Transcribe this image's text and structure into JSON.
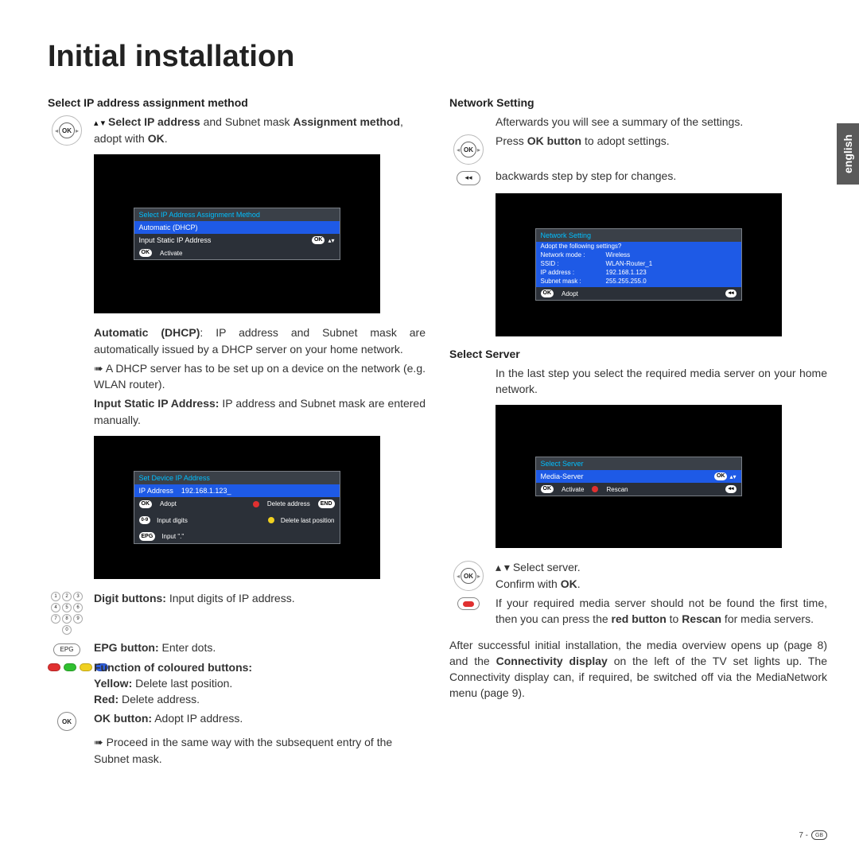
{
  "page_title": "Initial installation",
  "language_tab": "english",
  "footer": {
    "page": "7 -",
    "region": "GB"
  },
  "left": {
    "section1_title": "Select IP address assignment method",
    "instr1_pre": "▴ ▾ ",
    "instr1_bold1": "Select IP address",
    "instr1_mid": " and Subnet mask ",
    "instr1_bold2": "Assignment method",
    "instr1_tail": ",",
    "instr1_line2a": "adopt with ",
    "instr1_line2b": "OK",
    "instr1_line2c": ".",
    "tv1": {
      "header": "Select IP Address Assignment Method",
      "row1": "Automatic (DHCP)",
      "row2": "Input Static IP Address",
      "footer_ok": "OK",
      "footer_label": "Activate"
    },
    "auto_label": "Automatic (DHCP)",
    "auto_text": ": IP address and Subnet mask are automatically issued by a DHCP server on your home network.",
    "auto_bullet": "A DHCP server has to be set up on a device on the network (e.g. WLAN router).",
    "static_label": "Input Static IP Address:",
    "static_text": " IP address and Subnet mask are entered manually.",
    "tv2": {
      "header": "Set Device IP Address",
      "ip_label": "IP Address",
      "ip_value": "192.168.1.123_",
      "f_ok": "OK",
      "f_adopt": "Adopt",
      "f_del_addr": "Delete address",
      "f_digits": "Input digits",
      "f_del_last": "Delete last position",
      "f_epg": "EPG",
      "f_dot": "Input \".\"",
      "f_end": "END"
    },
    "digit_label": "Digit buttons:",
    "digit_text": " Input digits of IP address.",
    "epg_label": "EPG button:",
    "epg_text": " Enter dots.",
    "colour_title": "Function of coloured buttons:",
    "yellow_label": "Yellow:",
    "yellow_text": " Delete last position.",
    "red_label": "Red:",
    "red_text": " Delete address.",
    "okb_label": "OK button:",
    "okb_text": " Adopt IP address.",
    "proceed_text": "Proceed in the same way with the subsequent entry of the Subnet mask."
  },
  "right": {
    "net_title": "Network Setting",
    "net_line1": "Afterwards you will see a summary of the settings.",
    "net_line2a": "Press ",
    "net_line2b": "OK button",
    "net_line2c": " to adopt settings.",
    "net_line3": "backwards step by step for changes.",
    "tv3": {
      "header": "Network Setting",
      "q": "Adopt the following settings?",
      "mode_k": "Network mode :",
      "mode_v": "Wireless",
      "ssid_k": "SSID :",
      "ssid_v": "WLAN-Router_1",
      "ip_k": "IP address :",
      "ip_v": "192.168.1.123",
      "mask_k": "Subnet mask :",
      "mask_v": "255.255.255.0",
      "footer_ok": "OK",
      "footer_label": "Adopt"
    },
    "srv_title": "Select Server",
    "srv_text": "In the last step you select the required media server on your home network.",
    "tv4": {
      "header": "Select Server",
      "row": "Media-Server",
      "f_ok": "OK",
      "f_activate": "Activate",
      "f_rescan": "Rescan"
    },
    "sel_line1": "▴ ▾ Select server.",
    "sel_line2a": "Confirm with ",
    "sel_line2b": "OK",
    "sel_line2c": ".",
    "notfound_a": "If your required media server should not be found the first time, then you can press the ",
    "notfound_b": "red button",
    "notfound_c": " to ",
    "notfound_d": "Rescan",
    "notfound_e": " for media servers.",
    "after_a": "After successful initial installation, the media overview opens up (page 8) and the ",
    "after_b": "Connectivity display",
    "after_c": " on the left of the TV set lights up. The Connectivity display can, if required, be switched off via the MediaNetwork menu (page 9)."
  }
}
